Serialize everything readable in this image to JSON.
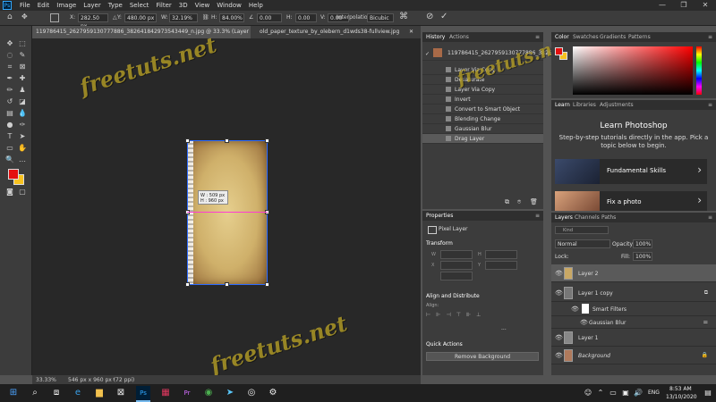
{
  "app": {
    "logo": "Ps"
  },
  "menu": [
    "File",
    "Edit",
    "Image",
    "Layer",
    "Type",
    "Select",
    "Filter",
    "3D",
    "View",
    "Window",
    "Help"
  ],
  "window_controls": [
    "—",
    "❐",
    "✕"
  ],
  "options_bar": {
    "x_label": "X:",
    "x_value": "282.50 px",
    "y_label": "Y:",
    "y_value": "480.00 px",
    "w_label": "W:",
    "w_value": "32.19%",
    "h_label": "H:",
    "h_value": "84.00%",
    "angle_value": "0.00",
    "hskew_label": "H:",
    "hskew_value": "0.00",
    "vskew_label": "V:",
    "vskew_value": "0.00",
    "interp_label": "Interpolation:",
    "interp_value": "Bicubic"
  },
  "doc_tabs": [
    {
      "label": "119786415_2627959130777886_382641842973543449_n.jpg @ 33.3% (Layer 2, RGB/8#) *",
      "close": "✕"
    },
    {
      "label": "old_paper_texture_by_olebern_d1wds38-fullview.jpg",
      "close": "✕"
    }
  ],
  "transform_tip": {
    "w": "W : 509 px",
    "h": "H : 960 px"
  },
  "status_bar": {
    "zoom": "33.33%",
    "doc": "546 px x 960 px (72 ppi)"
  },
  "history": {
    "tabs": [
      "History",
      "Actions"
    ],
    "snapshot": "119786415_2627959130777886_382641842...",
    "items": [
      "Layer Via Copy",
      "Desaturate",
      "Layer Via Copy",
      "Invert",
      "Convert to Smart Object",
      "Blending Change",
      "Gaussian Blur",
      "Drag Layer"
    ]
  },
  "properties": {
    "tab": "Properties",
    "kind": "Pixel Layer",
    "transform_title": "Transform",
    "transform_fields": [
      "W",
      "H",
      "X",
      "Y"
    ],
    "align_title": "Align and Distribute",
    "align_label": "Align:",
    "more": "...",
    "quick_title": "Quick Actions",
    "remove_bg": "Remove Background"
  },
  "color": {
    "tabs": [
      "Color",
      "Swatches",
      "Gradients",
      "Patterns"
    ],
    "foreground": "#e41010",
    "background": "#f7c21f"
  },
  "learn": {
    "tabs": [
      "Learn",
      "Libraries",
      "Adjustments"
    ],
    "title": "Learn Photoshop",
    "subtitle": "Step-by-step tutorials directly in the app. Pick a topic below to begin.",
    "cards": [
      {
        "label": "Fundamental Skills",
        "arrow": "›"
      },
      {
        "label": "Fix a photo",
        "arrow": "›"
      }
    ]
  },
  "layers": {
    "tabs": [
      "Layers",
      "Channels",
      "Paths"
    ],
    "filter_placeholder": "Kind",
    "blend_mode": "Normal",
    "opacity_label": "Opacity:",
    "opacity_value": "100%",
    "lock_label": "Lock:",
    "fill_label": "Fill:",
    "fill_value": "100%",
    "items": [
      {
        "name": "Layer 2"
      },
      {
        "name": "Layer 1 copy"
      },
      {
        "name": "Smart Filters"
      },
      {
        "name": "Gaussian Blur"
      },
      {
        "name": "Layer 1"
      },
      {
        "name": "Background"
      }
    ]
  },
  "watermark": "freetuts.net",
  "taskbar": {
    "time": "8:53 AM",
    "date": "13/10/2020",
    "lang": "ENG"
  }
}
